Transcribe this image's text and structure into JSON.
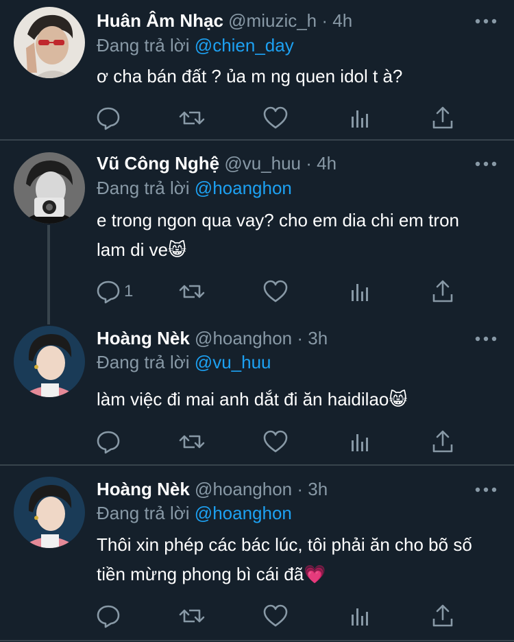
{
  "tweets": [
    {
      "display_name": "Huân Âm Nhạc",
      "handle": "@miuzic_h",
      "separator": "·",
      "time": "4h",
      "reply_prefix": "Đang trả lời",
      "reply_to": "@chien_day",
      "text": "ơ cha bán đất ? ủa m ng quen idol t à?",
      "reply_count": ""
    },
    {
      "display_name": "Vũ Công Nghệ",
      "handle": "@vu_huu",
      "separator": "·",
      "time": "4h",
      "reply_prefix": "Đang trả lời",
      "reply_to": "@hoanghon",
      "text": "e trong ngon qua vay? cho em dia chi em tron lam di ve😸",
      "reply_count": "1"
    },
    {
      "display_name": "Hoàng Nèk",
      "handle": "@hoanghon",
      "separator": "·",
      "time": "3h",
      "reply_prefix": "Đang trả lời",
      "reply_to": "@vu_huu",
      "text": "làm việc đi mai anh dắt đi ăn haidilao😸",
      "reply_count": ""
    },
    {
      "display_name": "Hoàng Nèk",
      "handle": "@hoanghon",
      "separator": "·",
      "time": "3h",
      "reply_prefix": "Đang trả lời",
      "reply_to": "@hoanghon",
      "text": "Thôi xin phép các bác lúc, tôi phải ăn cho bõ số tiền mừng phong bì cái đã💗",
      "reply_count": ""
    }
  ],
  "icons": {
    "more": "more-dots-icon",
    "reply": "reply-bubble-icon",
    "retweet": "retweet-arrows-icon",
    "like": "heart-icon",
    "analytics": "analytics-bars-icon",
    "share": "share-upload-icon"
  },
  "colors": {
    "background": "#15202b",
    "divider": "#38444d",
    "text_primary": "#ffffff",
    "text_secondary": "#8899a6",
    "link": "#1da1f2"
  }
}
